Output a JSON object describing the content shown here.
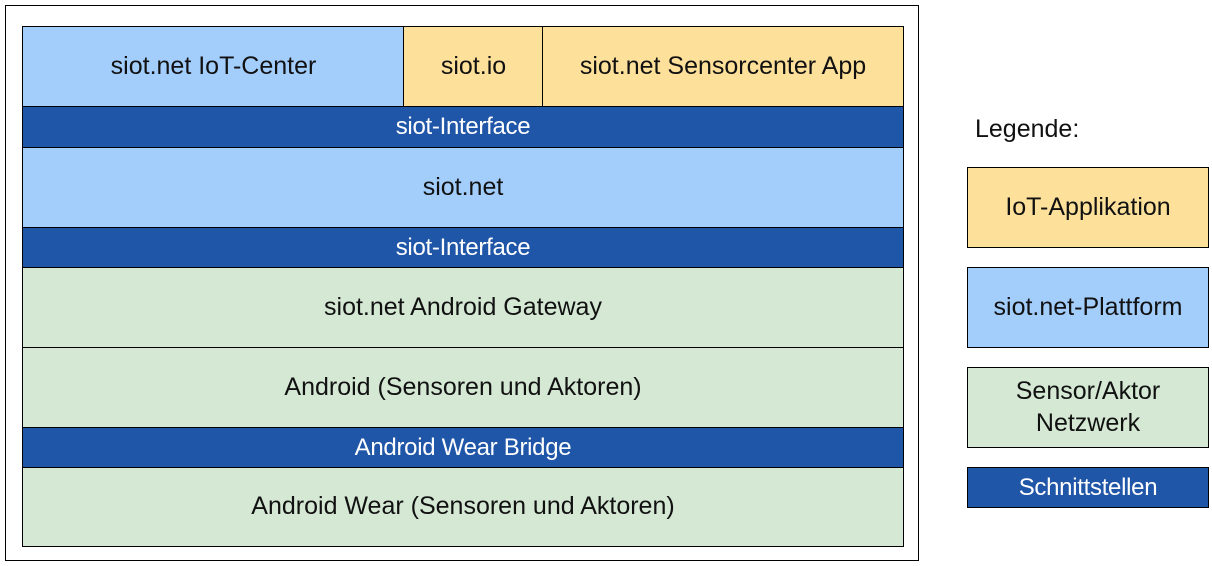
{
  "diagram": {
    "row1": {
      "iot_center": "siot.net IoT-Center",
      "siot_io": "siot.io",
      "sensorcenter_app": "siot.net Sensorcenter App"
    },
    "interface_1": "siot-Interface",
    "siot_net": "siot.net",
    "interface_2": "siot-Interface",
    "android_gateway": "siot.net Android Gateway",
    "android": "Android (Sensoren und Aktoren)",
    "wear_bridge": "Android Wear Bridge",
    "android_wear": "Android Wear (Sensoren und Aktoren)"
  },
  "legend": {
    "title": "Legende:",
    "items": [
      {
        "label": "IoT-Applikation",
        "color": "#fde19b"
      },
      {
        "label": "siot.net-Plattform",
        "color": "#a3cdfb"
      },
      {
        "label": "Sensor/Aktor Netzwerk",
        "color": "#d4e8d4"
      },
      {
        "label": "Schnittstellen",
        "color": "#2056a8"
      }
    ]
  },
  "colors": {
    "iot_application": "#fde19b",
    "platform": "#a3cdfb",
    "sensor_network": "#d4e8d4",
    "interface": "#2056a8"
  }
}
